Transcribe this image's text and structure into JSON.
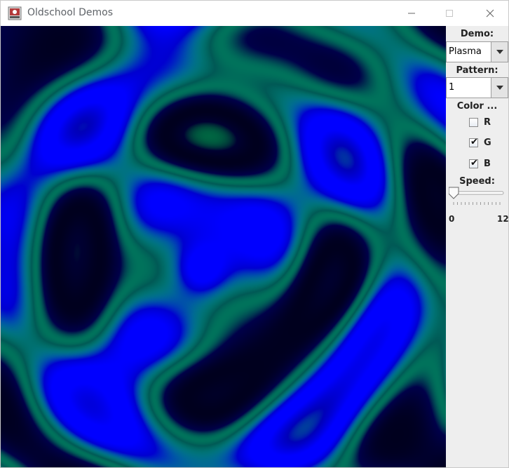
{
  "window": {
    "title": "Oldschool Demos"
  },
  "titlebar_icons": {
    "app": "app-icon",
    "minimize": "minimize-icon",
    "maximize": "maximize-icon",
    "close": "close-icon"
  },
  "controls": {
    "demo_label": "Demo:",
    "demo_value": "Plasma",
    "pattern_label": "Pattern:",
    "pattern_value": "1",
    "color_label": "Color ...",
    "channels": [
      {
        "label": "R",
        "checked": false
      },
      {
        "label": "G",
        "checked": true
      },
      {
        "label": "B",
        "checked": true
      }
    ],
    "speed_label": "Speed:",
    "speed_min": "0",
    "speed_max": "12",
    "speed_value": 0
  },
  "colors": {
    "plasma_base": "#0000ff",
    "plasma_cyan": "#00ffff",
    "plasma_green": "#00ff00",
    "plasma_dark": "#000010"
  }
}
